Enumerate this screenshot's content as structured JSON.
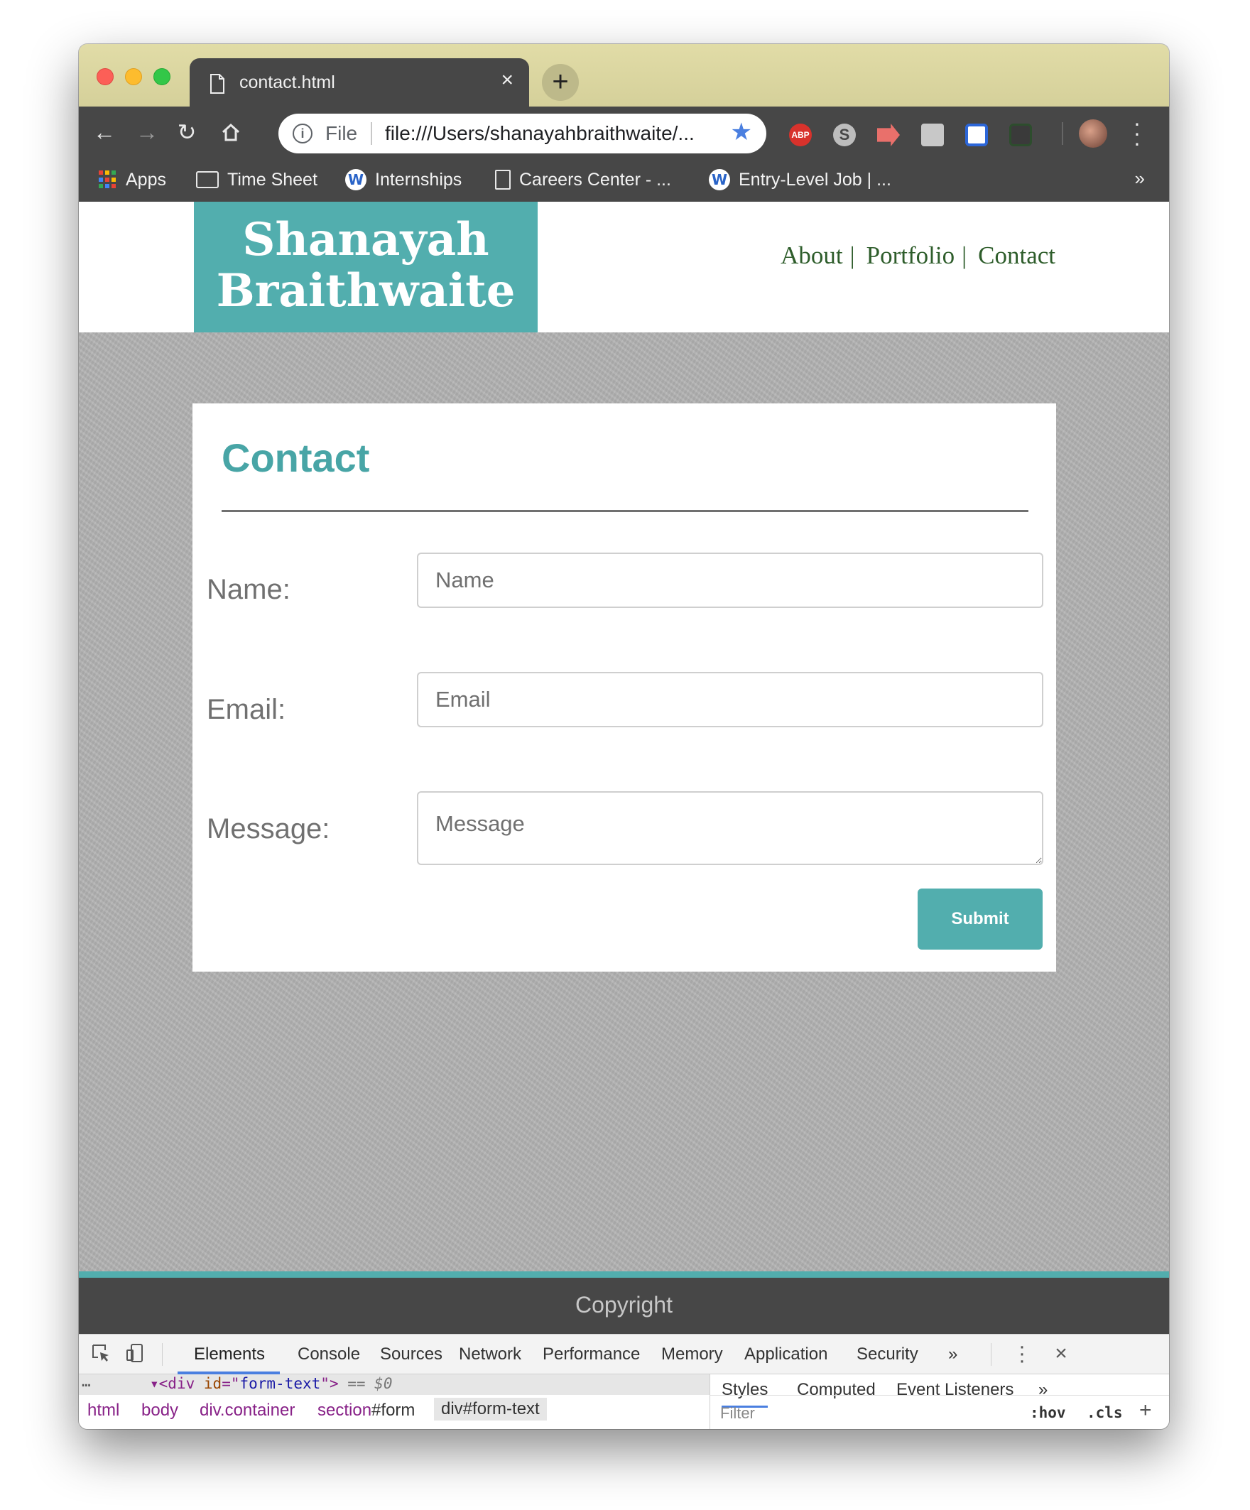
{
  "browser": {
    "tab": {
      "title": "contact.html",
      "new_tab_label": "+"
    },
    "omnibox": {
      "scheme_label": "File",
      "url": "file:///Users/shanayahbraithwaite/..."
    },
    "extensions": [
      "adblock-plus-icon",
      "skype-icon",
      "screen-record-icon",
      "screenshot-icon",
      "crop-icon",
      "window-capture-icon"
    ],
    "bookmarks": [
      {
        "label": "Apps",
        "icon": "apps-grid-icon"
      },
      {
        "label": "Time Sheet",
        "icon": "folder-icon"
      },
      {
        "label": "Internships",
        "icon": "w-logo-icon"
      },
      {
        "label": "Careers Center - ...",
        "icon": "document-icon"
      },
      {
        "label": "Entry-Level Job | ...",
        "icon": "w-logo-icon"
      }
    ],
    "bookmarks_more": "»"
  },
  "site": {
    "logo_line1": "Shanayah",
    "logo_line2": "Braithwaite",
    "nav": {
      "about": "About",
      "portfolio": "Portfolio",
      "contact": "Contact",
      "separator": "|"
    },
    "contact_card": {
      "title": "Contact",
      "fields": {
        "name": {
          "label": "Name:",
          "placeholder": "Name"
        },
        "email": {
          "label": "Email:",
          "placeholder": "Email"
        },
        "message": {
          "label": "Message:",
          "placeholder": "Message"
        }
      },
      "submit_label": "Submit"
    },
    "footer_text": "Copyright",
    "colors": {
      "accent": "#52aeae",
      "title": "#48a5a6",
      "nav": "#2e5d2b",
      "dark": "#474747"
    }
  },
  "devtools": {
    "tabs": [
      "Elements",
      "Console",
      "Sources",
      "Network",
      "Performance",
      "Memory",
      "Application",
      "Security"
    ],
    "tabs_more": "»",
    "selected_node": {
      "tag_open": "<div",
      "attr_name": "id",
      "attr_value": "form-text",
      "tag_close": ">",
      "marker": "== $0"
    },
    "breadcrumbs": [
      {
        "tag": "html",
        "rest": ""
      },
      {
        "tag": "body",
        "rest": ""
      },
      {
        "tag": "div",
        "rest": ".container"
      },
      {
        "tag": "section",
        "rest": "#form"
      },
      {
        "tag": "div",
        "rest": "#form-text"
      }
    ],
    "styles_tabs": [
      "Styles",
      "Computed",
      "Event Listeners"
    ],
    "styles_more": "»",
    "filter_placeholder": "Filter",
    "hov": ":hov",
    "cls": ".cls"
  }
}
